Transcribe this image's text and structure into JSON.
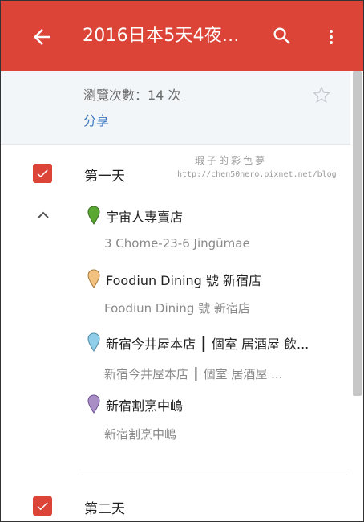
{
  "app_bar": {
    "title": "2016日本5天4夜...",
    "color": "#db4437",
    "icons": [
      "back-arrow-icon",
      "search-icon",
      "more-vert-icon"
    ]
  },
  "info": {
    "views_text": "瀏覽次數：14 次",
    "share_label": "分享"
  },
  "days": [
    {
      "label": "第一天",
      "checked": true,
      "places": [
        {
          "name": "宇宙人專賣店",
          "address": "3 Chome-23-6 Jingūmae",
          "pin_color": "#5aa832"
        },
        {
          "name": "Foodiun Dining 號 新宿店",
          "address": "Foodiun Dining 號 新宿店",
          "pin_color": "#f3c17f"
        },
        {
          "name": "新宿今井屋本店 ┃ 個室 居酒屋 飲...",
          "address": "新宿今井屋本店 ┃ 個室 居酒屋 ...",
          "pin_color": "#8fcde8"
        },
        {
          "name": "新宿割烹中嶋",
          "address": "新宿割烹中嶋",
          "pin_color": "#a98ec6"
        }
      ]
    },
    {
      "label": "第二天",
      "checked": true,
      "places": []
    }
  ],
  "watermark": {
    "line1": "瑕子的彩色夢",
    "line2": "http://chen50hero.pixnet.net/blog"
  }
}
